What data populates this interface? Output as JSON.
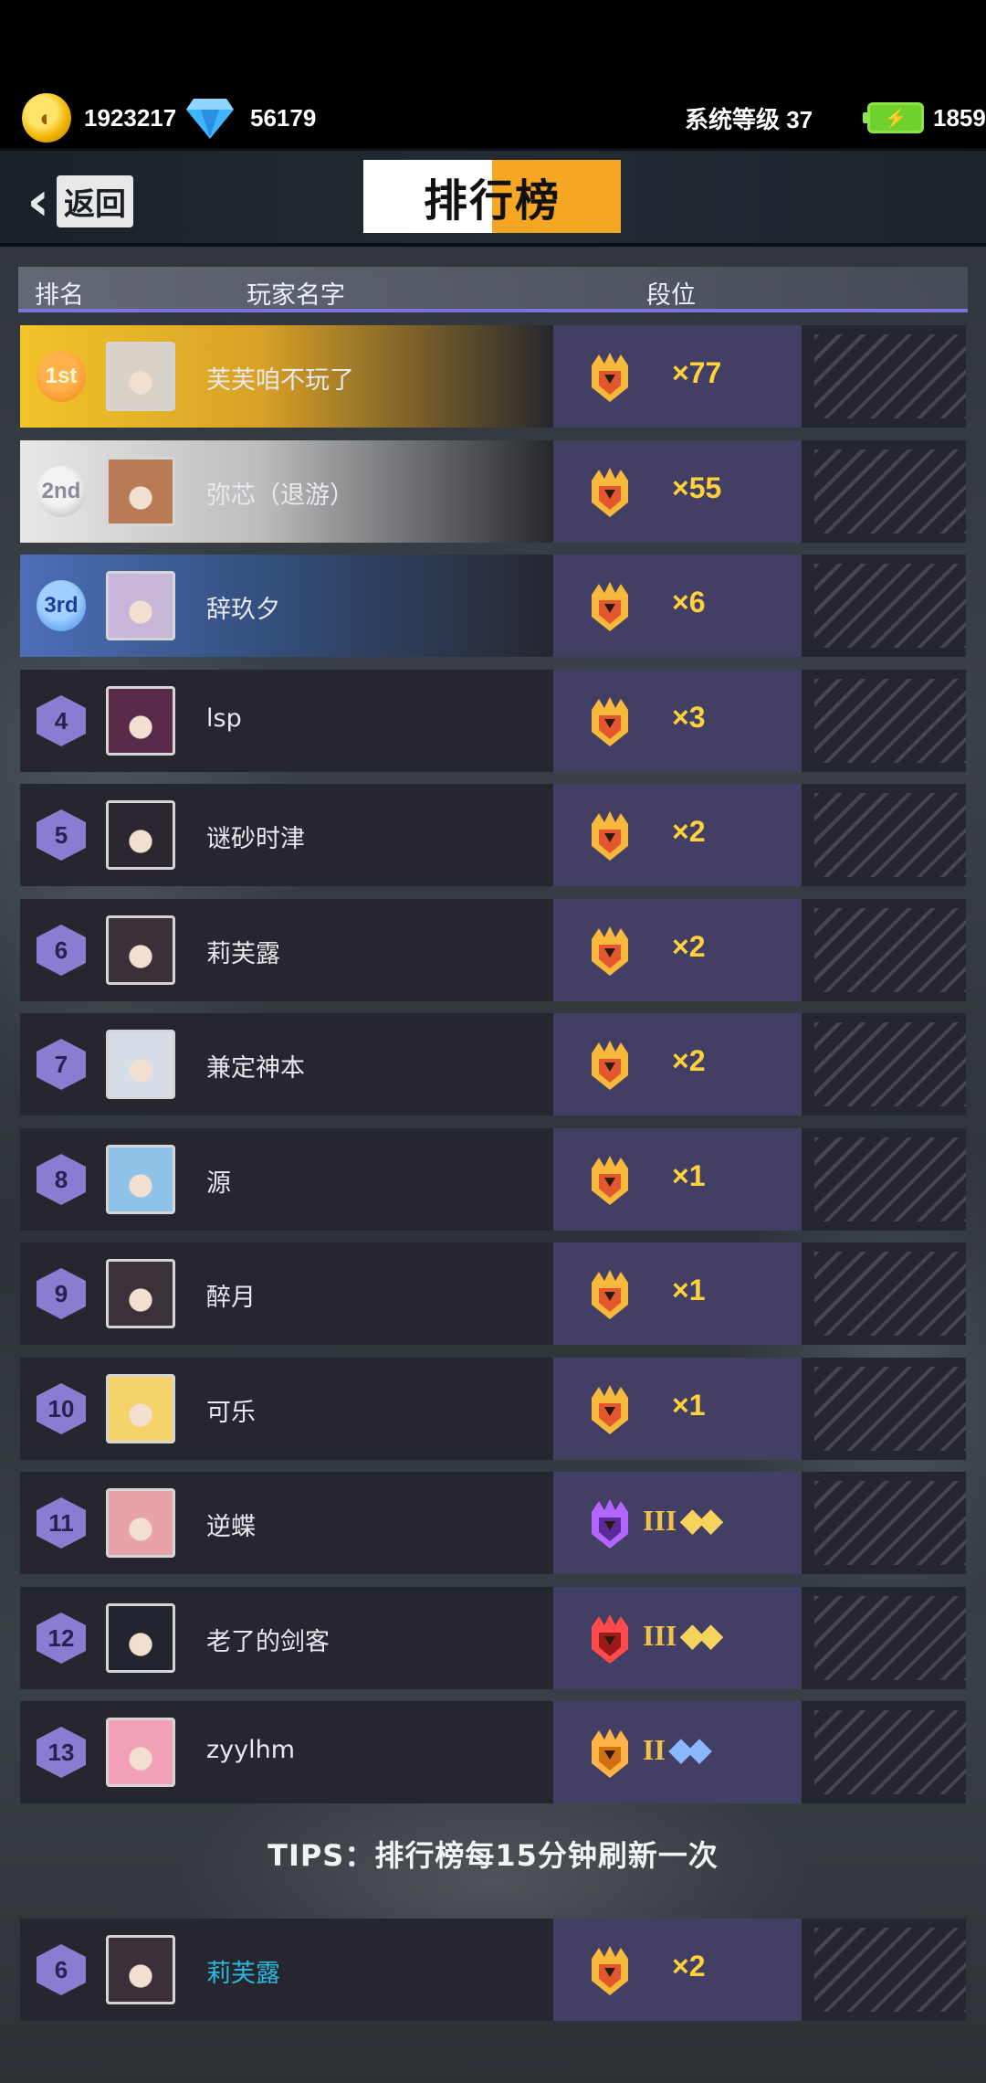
{
  "status": {
    "coins": "1923217",
    "gems": "56179",
    "system_level": "系统等级 37",
    "energy": "1859"
  },
  "header": {
    "back_label": "返回",
    "title": "排行榜"
  },
  "columns": {
    "rank": "排名",
    "name": "玩家名字",
    "tier": "段位"
  },
  "rows": [
    {
      "rank": "1st",
      "name": "芙芙咱不玩了",
      "tier_text": "×77",
      "style": "gold",
      "crest": "gold-crown"
    },
    {
      "rank": "2nd",
      "name": "弥芯（退游）",
      "tier_text": "×55",
      "style": "silver",
      "crest": "gold-crown"
    },
    {
      "rank": "3rd",
      "name": "辞玖夕",
      "tier_text": "×6",
      "style": "bronze",
      "crest": "gold-crown"
    },
    {
      "rank": "4",
      "name": "lsp",
      "tier_text": "×3",
      "style": "normal",
      "crest": "gold-crown"
    },
    {
      "rank": "5",
      "name": "谜砂时津",
      "tier_text": "×2",
      "style": "normal",
      "crest": "gold-crown"
    },
    {
      "rank": "6",
      "name": "莉芙露",
      "tier_text": "×2",
      "style": "normal",
      "crest": "gold-crown"
    },
    {
      "rank": "7",
      "name": "兼定神本",
      "tier_text": "×2",
      "style": "normal",
      "crest": "gold-crown"
    },
    {
      "rank": "8",
      "name": "源",
      "tier_text": "×1",
      "style": "normal",
      "crest": "gold-crown"
    },
    {
      "rank": "9",
      "name": "醉月",
      "tier_text": "×1",
      "style": "normal",
      "crest": "gold-crown"
    },
    {
      "rank": "10",
      "name": "可乐",
      "tier_text": "×1",
      "style": "normal",
      "crest": "gold-crown"
    },
    {
      "rank": "11",
      "name": "逆蝶",
      "tier_roman": "III",
      "tier_stars": "◆◆",
      "star_color": "gold",
      "style": "normal",
      "crest": "purple-crest"
    },
    {
      "rank": "12",
      "name": "老了的剑客",
      "tier_roman": "III",
      "tier_stars": "◆◆",
      "star_color": "gold",
      "style": "normal",
      "crest": "red-crest"
    },
    {
      "rank": "13",
      "name": "zyylhm",
      "tier_roman": "II",
      "tier_stars": "◆◆",
      "star_color": "blue",
      "style": "normal",
      "crest": "orange-crest"
    }
  ],
  "tips": "TIPS：排行榜每15分钟刷新一次",
  "my_row": {
    "rank": "6",
    "name": "莉芙露",
    "tier_text": "×2",
    "crest": "gold-crown"
  },
  "colors": {
    "accent_gold": "#ffd23b",
    "rank_cell": "#433e63",
    "hex_badge": "#8b7bd1",
    "my_name": "#2bb8e0"
  }
}
